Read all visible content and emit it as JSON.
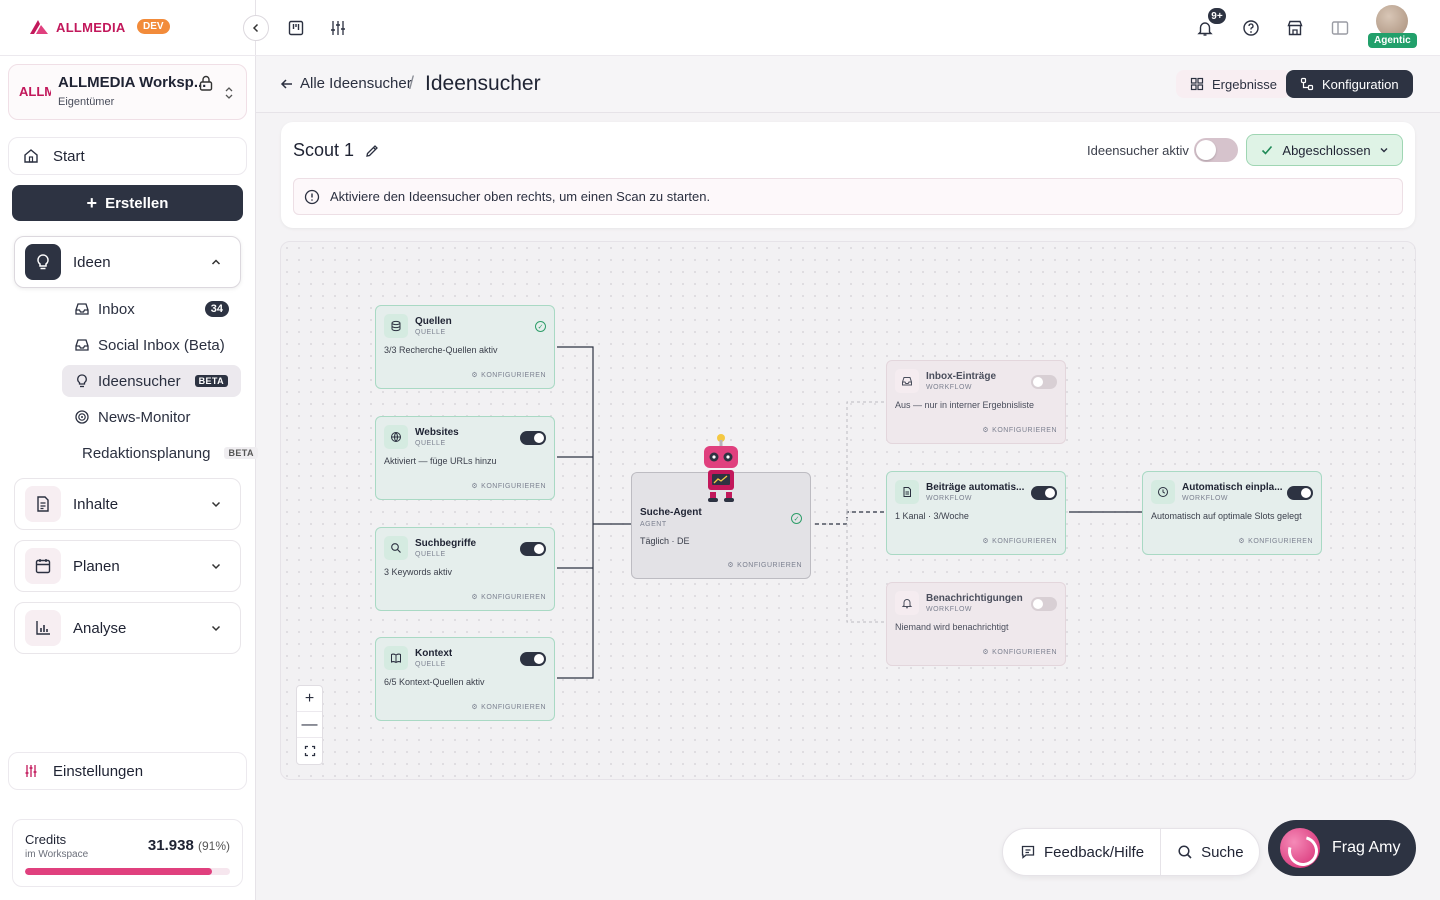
{
  "brand": {
    "name": "ALLMEDIA",
    "env_badge": "DEV",
    "accent": "#c2185b"
  },
  "workspace": {
    "logo_text": "ALLMEDIA",
    "name": "ALLMEDIA Worksp...",
    "role": "Eigentümer"
  },
  "sidebar": {
    "start": "Start",
    "create": "Erstellen",
    "groups": [
      {
        "label": "Ideen",
        "expanded": true,
        "icon": "lightbulb-icon"
      },
      {
        "label": "Inhalte",
        "expanded": false,
        "icon": "document-icon"
      },
      {
        "label": "Planen",
        "expanded": false,
        "icon": "calendar-icon"
      },
      {
        "label": "Analyse",
        "expanded": false,
        "icon": "bar-chart-icon"
      }
    ],
    "ideen_items": [
      {
        "label": "Inbox",
        "count": "34",
        "icon": "inbox-icon"
      },
      {
        "label": "Social Inbox (Beta)",
        "icon": "inbox-icon"
      },
      {
        "label": "Ideensucher",
        "tag": "BETA",
        "selected": true,
        "icon": "lightbulb-icon"
      },
      {
        "label": "News-Monitor",
        "icon": "radar-icon"
      },
      {
        "label": "Redaktionsplanung",
        "tag": "BETA"
      }
    ],
    "settings": "Einstellungen",
    "credits": {
      "label": "Credits",
      "sublabel": "im Workspace",
      "value": "31.938",
      "percent_text": "(91%)",
      "percent": 91
    }
  },
  "topbar": {
    "notifications_badge": "9+",
    "agentic_label": "Agentic"
  },
  "page": {
    "back_label": "Alle Ideensucher",
    "separator": "/",
    "title": "Ideensucher",
    "tabs": {
      "results": "Ergebnisse",
      "config": "Konfiguration"
    }
  },
  "scout": {
    "name": "Scout 1",
    "active_label": "Ideensucher aktiv",
    "active": false,
    "status": "Abgeschlossen",
    "info": "Aktiviere den Ideensucher oben rechts, um einen Scan zu starten."
  },
  "flow": {
    "configure_label": "KONFIGURIEREN",
    "sources": [
      {
        "title": "Quellen",
        "kind": "QUELLE",
        "desc": "3/3 Recherche-Quellen aktiv",
        "control": "check",
        "icon": "database-icon"
      },
      {
        "title": "Websites",
        "kind": "QUELLE",
        "desc": "Aktiviert — füge URLs hinzu",
        "control": "on",
        "icon": "globe-icon"
      },
      {
        "title": "Suchbegriffe",
        "kind": "QUELLE",
        "desc": "3 Keywords aktiv",
        "control": "on",
        "icon": "search-icon"
      },
      {
        "title": "Kontext",
        "kind": "QUELLE",
        "desc": "6/5 Kontext-Quellen aktiv",
        "control": "on",
        "icon": "book-icon"
      }
    ],
    "agent": {
      "title": "Suche-Agent",
      "kind": "AGENT",
      "desc": "Täglich · DE"
    },
    "workflows": [
      {
        "title": "Inbox-Einträge",
        "kind": "WORKFLOW",
        "desc": "Aus — nur in interner Ergebnisliste",
        "control": "off",
        "icon": "inbox-icon"
      },
      {
        "title": "Beiträge automatis...",
        "kind": "WORKFLOW",
        "desc": "1 Kanal · 3/Woche",
        "control": "on",
        "icon": "document-icon"
      },
      {
        "title": "Benachrichtigungen",
        "kind": "WORKFLOW",
        "desc": "Niemand wird benachrichtigt",
        "control": "off",
        "icon": "bell-icon"
      },
      {
        "title": "Automatisch einpla...",
        "kind": "WORKFLOW",
        "desc": "Automatisch auf optimale Slots gelegt",
        "control": "on",
        "icon": "clock-icon"
      }
    ]
  },
  "bottom": {
    "feedback": "Feedback/Hilfe",
    "search": "Suche",
    "assistant": "Frag Amy"
  }
}
